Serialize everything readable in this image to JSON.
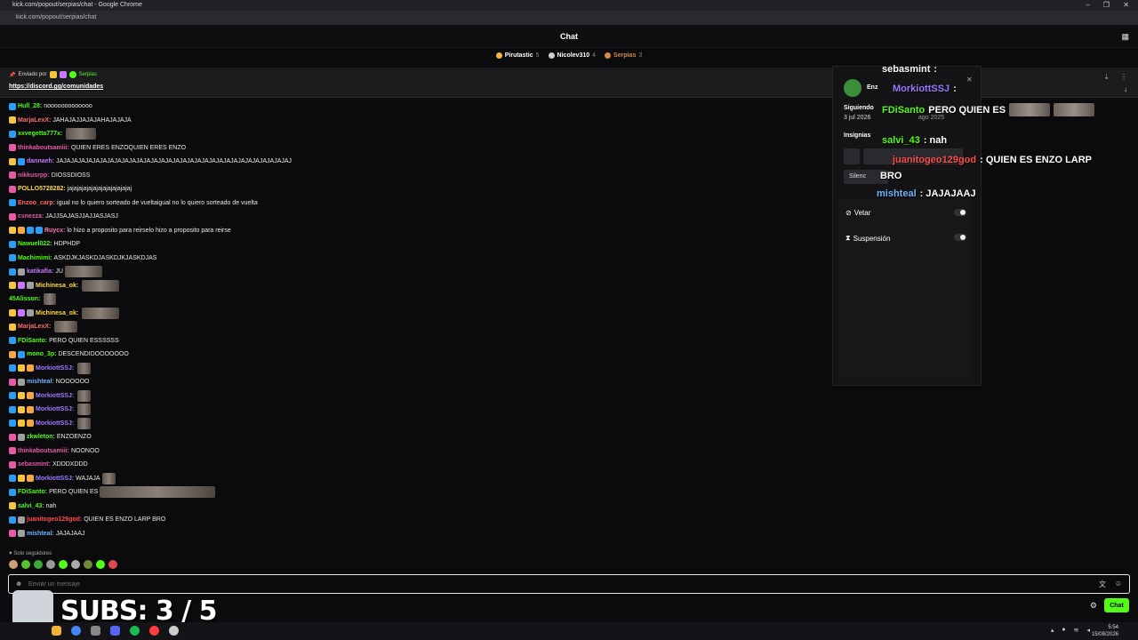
{
  "browser": {
    "title": "kick.com/popout/serpias/chat - Google Chrome",
    "url": "kick.com/popout/serpias/chat",
    "controls": [
      "–",
      "❐",
      "✕"
    ]
  },
  "header": {
    "title": "Chat",
    "menu_icon": "grid-menu-icon"
  },
  "top_gifters": [
    {
      "name": "Pirutastic",
      "count": "5",
      "color": "#f5b942"
    },
    {
      "name": "Nicolev310",
      "count": "4",
      "color": "#cfcfcf"
    },
    {
      "name": "Serpias",
      "count": "3",
      "color": "#d08a4e"
    }
  ],
  "pinned": {
    "sent_by_label": "Enviado por",
    "sent_by_user": "Serpias",
    "link": "https://discord.gg/comunidades"
  },
  "messages": [
    {
      "user": "Hull_28:",
      "text": " nooooooooooooo",
      "color": "#53fc18",
      "badges": [
        "#2a9df4"
      ]
    },
    {
      "user": "MarjaLexX:",
      "text": " JAHAJAJJAJAJAHAJAJAJA",
      "color": "#ff6b6b",
      "badges": [
        "#f5c542"
      ]
    },
    {
      "user": "xxvegetta777x:",
      "text": "",
      "color": "#53fc18",
      "badges": [
        "#2a9df4"
      ],
      "emote": 34
    },
    {
      "user": "thinkaboutsamiii:",
      "text": " QUIEN ERES ENZOQUIEN ERES ENZO",
      "color": "#e75aa5",
      "badges": [
        "#e75aa5"
      ]
    },
    {
      "user": "dannaeh:",
      "text": " JAJAJAJAJAJAJAJAJAJAJAJAJAJAJAJAJAJAJAJAJAJAJAJAJAJAJAJAJAJAJAJAJ",
      "color": "#c778ff",
      "badges": [
        "#f5c542",
        "#2a9df4"
      ]
    },
    {
      "user": "nikkusrpp:",
      "text": " DIOSSDIOSS",
      "color": "#e75aa5",
      "badges": [
        "#e75aa5"
      ]
    },
    {
      "user": "POLLO5728282:",
      "text": " jajajajajajajajajajajajajaj",
      "color": "#ffd84d",
      "badges": [
        "#e75aa5"
      ]
    },
    {
      "user": "Enzoo_carp:",
      "text": " igual no lo quiero sorteado de vueltaigual no lo quiero sorteado de vuelta",
      "color": "#ff6b6b",
      "badges": [
        "#2a9df4"
      ]
    },
    {
      "user": "csnezza:",
      "text": " JAJJSAJASJJAJJASJASJ",
      "color": "#e75aa5",
      "badges": [
        "#e75aa5"
      ]
    },
    {
      "user": "Ruycx:",
      "text": " lo hizo a proposito para reirselo hizo a proposito para reirse",
      "color": "#ff7ab8",
      "badges": [
        "#f5c542",
        "#f5a742",
        "#2a9df4",
        "#2a9df4"
      ]
    },
    {
      "user": "Nawuel022:",
      "text": " HDPHDP",
      "color": "#53fc18",
      "badges": [
        "#2a9df4"
      ]
    },
    {
      "user": "Machimimi:",
      "text": " ASKDJKJASKDJASKDJKJASKDJAS",
      "color": "#53fc18",
      "badges": [
        "#2a9df4"
      ]
    },
    {
      "user": "katikafia:",
      "text": " JU",
      "color": "#c778ff",
      "badges": [
        "#2a9df4",
        "#a0a0a0"
      ],
      "emote": 42
    },
    {
      "user": "Michinesa_ok:",
      "text": "",
      "color": "#ffd84d",
      "badges": [
        "#f5c542",
        "#c778ff",
        "#a0a0a0"
      ],
      "emote": 42
    },
    {
      "user": "45Alisson:",
      "text": "",
      "color": "#53fc18",
      "badges": [],
      "emote": 14
    },
    {
      "user": "Michinesa_ok:",
      "text": "",
      "color": "#ffd84d",
      "badges": [
        "#f5c542",
        "#c778ff",
        "#a0a0a0"
      ],
      "emote": 42
    },
    {
      "user": "MarjaLexX:",
      "text": "",
      "color": "#ff6b6b",
      "badges": [
        "#f5c542"
      ],
      "emote": 26
    },
    {
      "user": "FDiSanto:",
      "text": " PERO QUIEN ESSSSSS",
      "color": "#53fc18",
      "badges": [
        "#2a9df4"
      ]
    },
    {
      "user": "mono_3p:",
      "text": " DESCENDIDOOOOOOO",
      "color": "#53fc18",
      "badges": [
        "#f5a742",
        "#2a9df4"
      ]
    },
    {
      "user": "MorkiottSSJ:",
      "text": "",
      "color": "#9b7bff",
      "badges": [
        "#2a9df4",
        "#f5c542",
        "#f5a742"
      ],
      "emote": 15
    },
    {
      "user": "mishteal:",
      "text": " NOOOOOO",
      "color": "#6fb3ff",
      "badges": [
        "#e75aa5",
        "#a0a0a0"
      ]
    },
    {
      "user": "MorkiottSSJ:",
      "text": "",
      "color": "#9b7bff",
      "badges": [
        "#2a9df4",
        "#f5c542",
        "#f5a742"
      ],
      "emote": 15
    },
    {
      "user": "MorkiottSSJ:",
      "text": "",
      "color": "#9b7bff",
      "badges": [
        "#2a9df4",
        "#f5c542",
        "#f5a742"
      ],
      "emote": 15
    },
    {
      "user": "MorkiottSSJ:",
      "text": "",
      "color": "#9b7bff",
      "badges": [
        "#2a9df4",
        "#f5c542",
        "#f5a742"
      ],
      "emote": 15
    },
    {
      "user": "zkwleton:",
      "text": " ENZOENZO",
      "color": "#53fc18",
      "badges": [
        "#e75aa5",
        "#a0a0a0"
      ]
    },
    {
      "user": "thinkaboutsamiii:",
      "text": " NOONOO",
      "color": "#e75aa5",
      "badges": [
        "#e75aa5"
      ]
    },
    {
      "user": "sebasmint:",
      "text": " XDDDXDDD",
      "color": "#e75aa5",
      "badges": [
        "#e75aa5"
      ]
    },
    {
      "user": "MorkiottSSJ:",
      "text": " WAJAJA",
      "color": "#9b7bff",
      "badges": [
        "#2a9df4",
        "#f5c542",
        "#f5a742"
      ],
      "emote": 15
    },
    {
      "user": "FDiSanto:",
      "text": " PERO QUIEN ES",
      "color": "#53fc18",
      "badges": [
        "#2a9df4"
      ],
      "emote": 130
    },
    {
      "user": "salvi_43:",
      "text": " nah",
      "color": "#53fc18",
      "badges": [
        "#f5c542"
      ]
    },
    {
      "user": "juanitogeo129god:",
      "text": " QUIEN ES ENZO LARP BRO",
      "color": "#ff4d4d",
      "badges": [
        "#2a9df4",
        "#a0a0a0"
      ]
    },
    {
      "user": "mishteal:",
      "text": " JAJAJAAJ",
      "color": "#6fb3ff",
      "badges": [
        "#e75aa5",
        "#a0a0a0"
      ]
    }
  ],
  "followers_only": "♥ Solo seguidores",
  "input": {
    "placeholder": "Enviar un mensaje"
  },
  "stream_overlay": {
    "subs": "SUBS: 3 / 5"
  },
  "send_button": "Chat",
  "user_card": {
    "name_partial": "Enz",
    "following_label": "Siguiendo",
    "following_date": "3 jul 2026",
    "joined_partial": "ago 2025",
    "badges_label": "Insignias",
    "silence_partial": "Silenc",
    "veto_label": "Vetar",
    "suspension_label": "Suspensión"
  },
  "floating_messages": [
    {
      "user": "sebasmint",
      "text": " :",
      "color": "#ffffff"
    },
    {
      "user": "MorkiottSSJ",
      "text": " :",
      "color": "#9b7bff"
    },
    {
      "user": "FDiSanto",
      "text": " PERO QUIEN ES",
      "color": "#53fc18"
    },
    {
      "user": "salvi_43",
      "text": " : nah",
      "color": "#53fc18"
    },
    {
      "user": "juanitogeo129god",
      "text": " : QUIEN ES ENZO LARP",
      "color": "#ff4d4d"
    },
    {
      "user": "BRO",
      "text": "",
      "color": "#ffffff"
    },
    {
      "user": "mishteal",
      "text": " : JAJAJAAJ",
      "color": "#6fb3ff"
    }
  ],
  "taskbar": {
    "time": "5:54",
    "date": "15/08/2026"
  }
}
